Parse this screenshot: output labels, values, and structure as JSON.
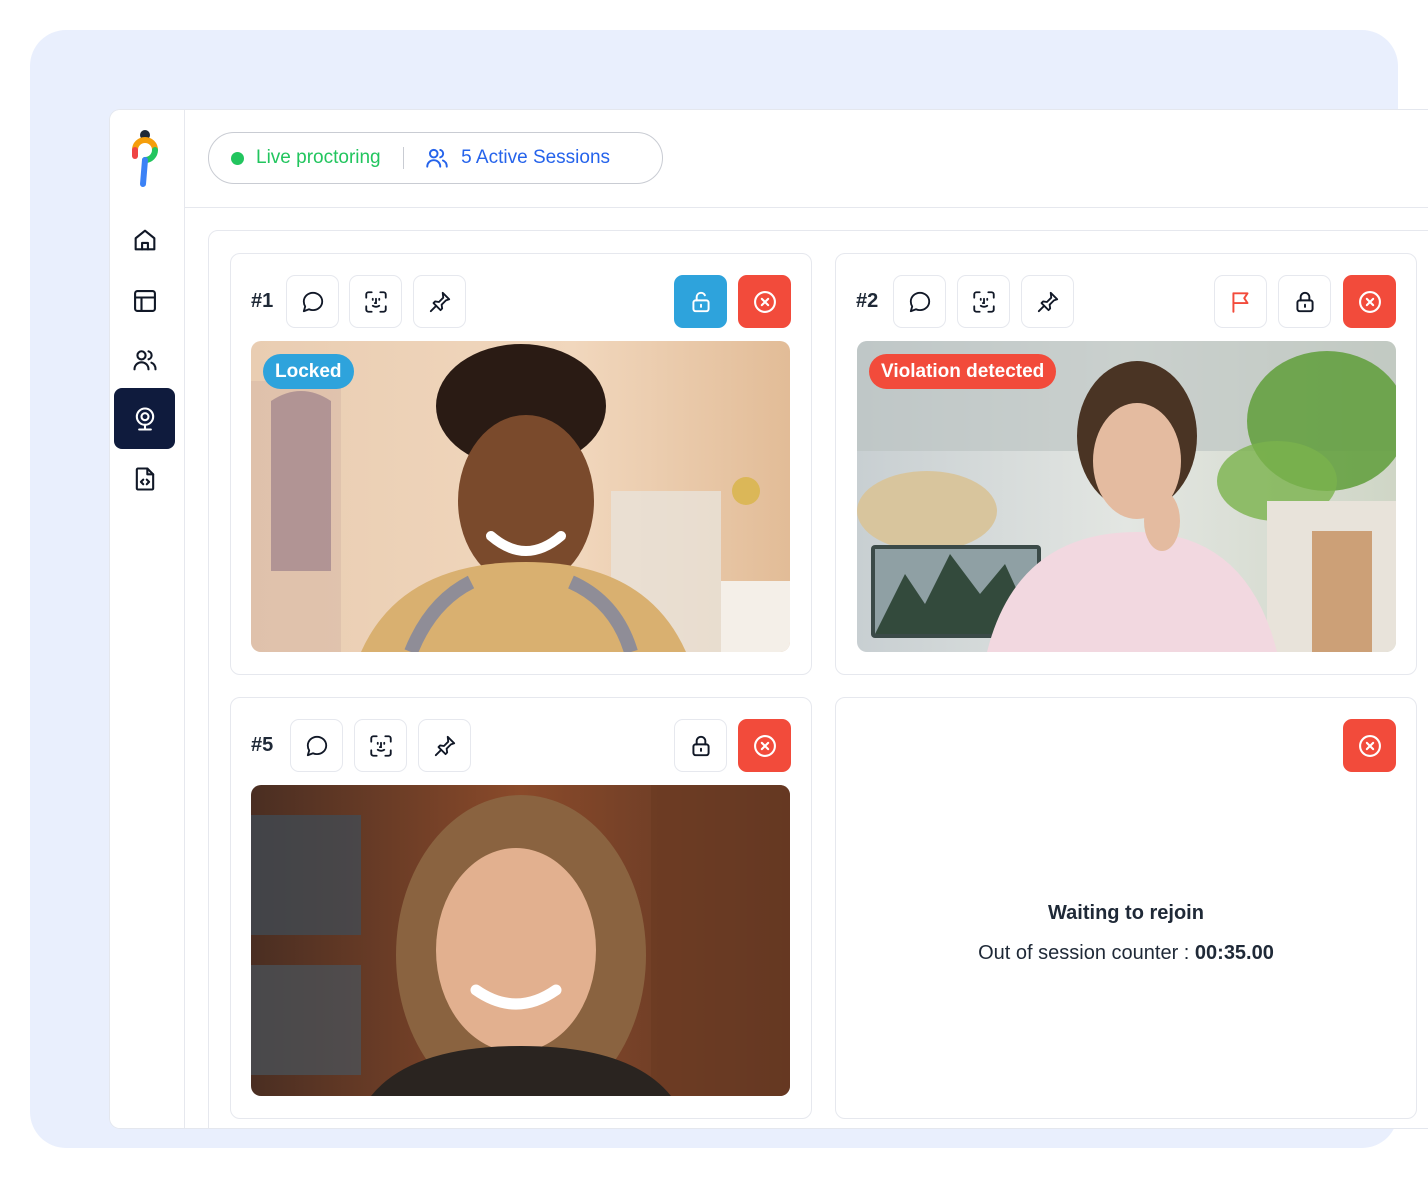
{
  "topbar": {
    "status_label": "Live proctoring",
    "sessions_label": "5 Active Sessions",
    "status_color": "#22c55e",
    "sessions_color": "#2563eb"
  },
  "sidebar": {
    "items": [
      {
        "icon": "home-icon"
      },
      {
        "icon": "layout-icon"
      },
      {
        "icon": "users-icon"
      },
      {
        "icon": "webcam-icon",
        "active": true
      },
      {
        "icon": "code-file-icon"
      }
    ]
  },
  "sessions": [
    {
      "number": "#1",
      "badge": "Locked",
      "locked": true
    },
    {
      "number": "#2",
      "badge": "Violation detected",
      "flagged": true
    },
    {
      "number": "#5",
      "badge": ""
    },
    {
      "waiting_title": "Waiting to rejoin",
      "counter_label": "Out of session counter : ",
      "counter_value": "00:35.00"
    }
  ],
  "colors": {
    "accent_blue": "#2ea3dc",
    "danger_red": "#f24b3b",
    "nav_active": "#0f1b3d"
  }
}
